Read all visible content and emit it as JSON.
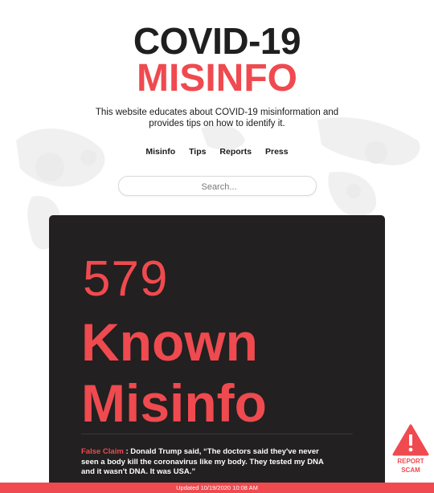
{
  "header": {
    "title_line1": "COVID-19",
    "title_line2": "MISINFO",
    "tagline": "This website educates about COVID-19 misinformation and provides tips on how to identify it."
  },
  "nav": {
    "items": [
      "Misinfo",
      "Tips",
      "Reports",
      "Press"
    ]
  },
  "search": {
    "placeholder": "Search..."
  },
  "stats": {
    "count": "579",
    "label_line1": "Known",
    "label_line2": "Misinfo"
  },
  "claim": {
    "label": "False Claim",
    "text": ": Donald Trump said, “The doctors said they've never seen a body kill the coronavirus like my body. They tested my DNA and it wasn't DNA. It was USA.”"
  },
  "report": {
    "label_line1": "REPORT",
    "label_line2": "SCAM",
    "icon": "warning-triangle-icon"
  },
  "footer": {
    "updated": "Updated 10/19/2020 10:08 AM"
  },
  "colors": {
    "accent": "#ef4a4f",
    "dark": "#1f1f1f",
    "card": "#222020"
  }
}
